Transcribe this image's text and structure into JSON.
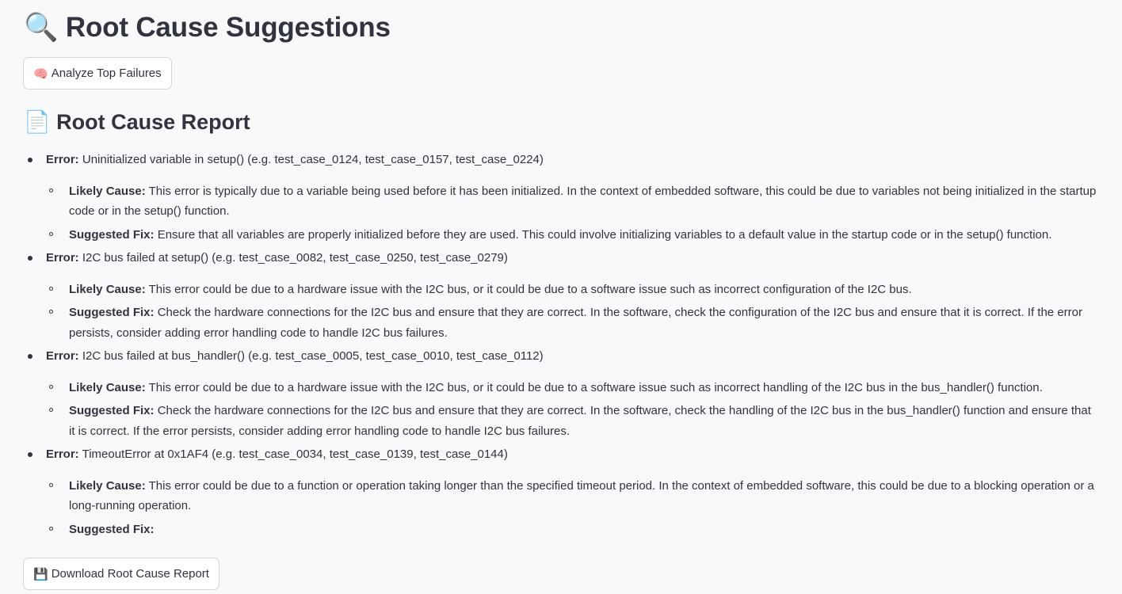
{
  "header": {
    "title_icon": "🔍",
    "title": "Root Cause Suggestions"
  },
  "analyze_button": {
    "icon": "🧠",
    "label": "Analyze Top Failures"
  },
  "report": {
    "heading_icon": "📄",
    "heading": "Root Cause Report",
    "error_label": "Error:",
    "likely_cause_label": "Likely Cause:",
    "suggested_fix_label": "Suggested Fix:",
    "errors": [
      {
        "error": "Uninitialized variable in setup() (e.g. test_case_0124, test_case_0157, test_case_0224)",
        "likely_cause": "This error is typically due to a variable being used before it has been initialized. In the context of embedded software, this could be due to variables not being initialized in the startup code or in the setup() function.",
        "suggested_fix": "Ensure that all variables are properly initialized before they are used. This could involve initializing variables to a default value in the startup code or in the setup() function."
      },
      {
        "error": "I2C bus failed at setup() (e.g. test_case_0082, test_case_0250, test_case_0279)",
        "likely_cause": "This error could be due to a hardware issue with the I2C bus, or it could be due to a software issue such as incorrect configuration of the I2C bus.",
        "suggested_fix": "Check the hardware connections for the I2C bus and ensure that they are correct. In the software, check the configuration of the I2C bus and ensure that it is correct. If the error persists, consider adding error handling code to handle I2C bus failures."
      },
      {
        "error": "I2C bus failed at bus_handler() (e.g. test_case_0005, test_case_0010, test_case_0112)",
        "likely_cause": "This error could be due to a hardware issue with the I2C bus, or it could be due to a software issue such as incorrect handling of the I2C bus in the bus_handler() function.",
        "suggested_fix": "Check the hardware connections for the I2C bus and ensure that they are correct. In the software, check the handling of the I2C bus in the bus_handler() function and ensure that it is correct. If the error persists, consider adding error handling code to handle I2C bus failures."
      },
      {
        "error": "TimeoutError at 0x1AF4 (e.g. test_case_0034, test_case_0139, test_case_0144)",
        "likely_cause": "This error could be due to a function or operation taking longer than the specified timeout period. In the context of embedded software, this could be due to a blocking operation or a long-running operation.",
        "suggested_fix": ""
      }
    ]
  },
  "download_button": {
    "icon": "💾",
    "label": "Download Root Cause Report"
  }
}
